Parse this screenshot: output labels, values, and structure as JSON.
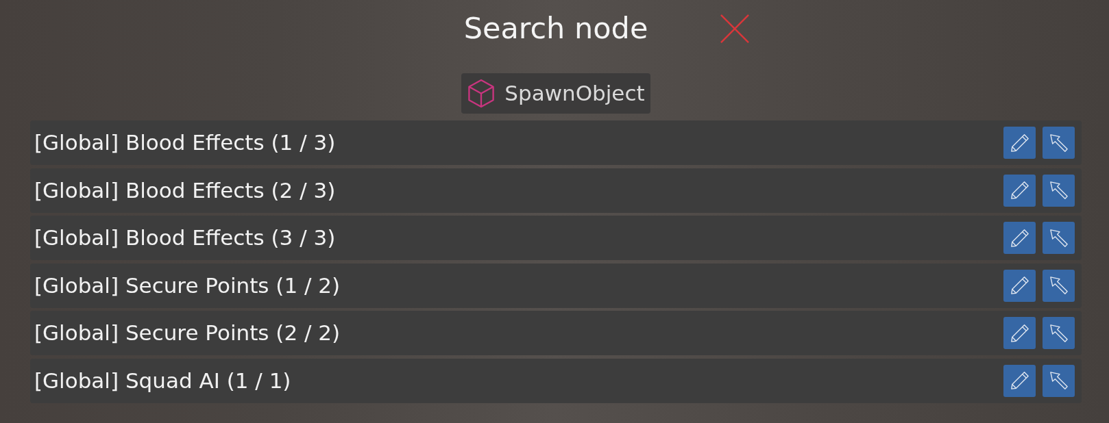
{
  "title": "Search node",
  "filter_chip": {
    "label": "SpawnObject"
  },
  "results": [
    {
      "label": "[Global] Blood Effects (1 / 3)"
    },
    {
      "label": "[Global] Blood Effects (2 / 3)"
    },
    {
      "label": "[Global] Blood Effects (3 / 3)"
    },
    {
      "label": "[Global] Secure Points (1 / 2)"
    },
    {
      "label": "[Global] Secure Points (2 / 2)"
    },
    {
      "label": "[Global] Squad AI (1 / 1)"
    }
  ]
}
